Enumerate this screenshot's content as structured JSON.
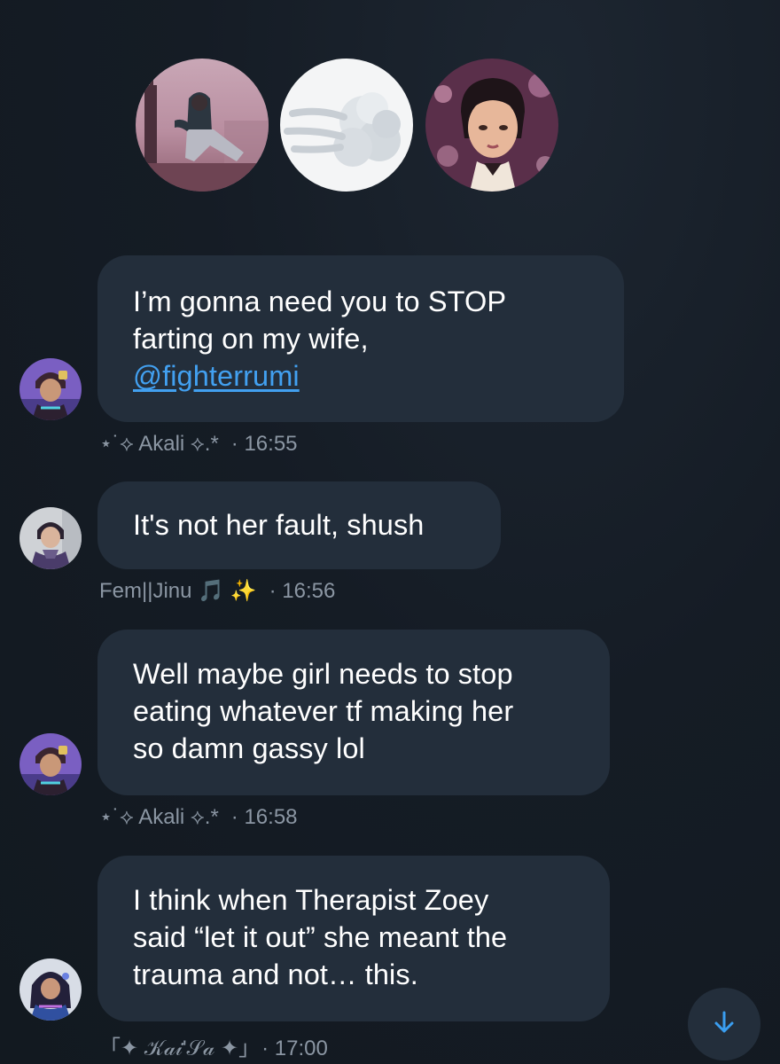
{
  "group_header": {
    "avatars": [
      {
        "icon": "person-sitting-avatar-icon"
      },
      {
        "icon": "wind-puff-emoji-icon"
      },
      {
        "icon": "animated-girl-avatar-icon"
      }
    ]
  },
  "messages": [
    {
      "lines": [
        "I’m gonna need you to STOP",
        "farting on my wife,",
        "@fighterrumi"
      ],
      "sender": "⋆˙⟡ Akali ⟡.*",
      "time": "· 16:55",
      "avatar_icon": "akali-avatar-icon"
    },
    {
      "lines": [
        "It's not her fault, shush"
      ],
      "sender": "Fem||Jinu 🎵 ✨",
      "time": "· 16:56",
      "avatar_icon": "jinu-avatar-icon"
    },
    {
      "lines": [
        "Well maybe girl needs to stop",
        "eating whatever tf making her",
        "so damn gassy lol"
      ],
      "sender": "⋆˙⟡ Akali ⟡.*",
      "time": "· 16:58",
      "avatar_icon": "akali-avatar-icon"
    },
    {
      "lines": [
        "I think when Therapist Zoey",
        "said “let it out” she meant the",
        "trauma and not… this."
      ],
      "sender": "「✦ 𝒦𝒶𝒾'𝒮𝒶 ✦」",
      "time": "· 17:00",
      "avatar_icon": "kaisa-avatar-icon"
    }
  ],
  "scroll_button": {
    "icon": "arrow-down-icon"
  },
  "colors": {
    "background": "#141b24",
    "bubble": "#232e3b",
    "mention": "#42a0f0",
    "meta_text": "#8b96a3"
  }
}
